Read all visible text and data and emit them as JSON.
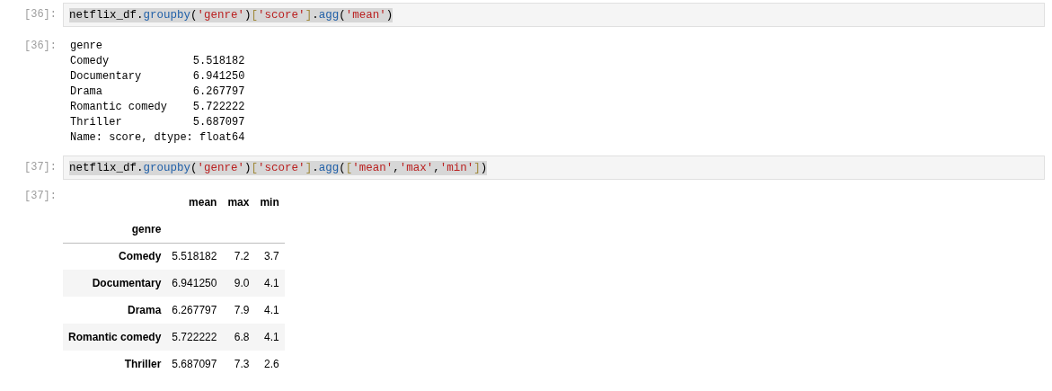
{
  "cells": [
    {
      "prompt_in": "[36]:",
      "input": {
        "highlighted": true,
        "tokens": [
          {
            "kind": "name",
            "text": "netflix_df"
          },
          {
            "kind": "op",
            "text": "."
          },
          {
            "kind": "func",
            "text": "groupby"
          },
          {
            "kind": "op",
            "text": "("
          },
          {
            "kind": "string",
            "text": "'genre'"
          },
          {
            "kind": "op",
            "text": ")"
          },
          {
            "kind": "bracket",
            "text": "["
          },
          {
            "kind": "string",
            "text": "'score'"
          },
          {
            "kind": "bracket",
            "text": "]"
          },
          {
            "kind": "op",
            "text": "."
          },
          {
            "kind": "func",
            "text": "agg"
          },
          {
            "kind": "op",
            "text": "("
          },
          {
            "kind": "string",
            "text": "'mean'"
          },
          {
            "kind": "op",
            "text": ")"
          }
        ]
      },
      "prompt_out": "[36]:",
      "output": {
        "kind": "text",
        "lines": [
          "genre",
          "Comedy             5.518182",
          "Documentary        6.941250",
          "Drama              6.267797",
          "Romantic comedy    5.722222",
          "Thriller           5.687097",
          "Name: score, dtype: float64"
        ]
      }
    },
    {
      "prompt_in": "[37]:",
      "input": {
        "highlighted": true,
        "tokens": [
          {
            "kind": "name",
            "text": "netflix_df"
          },
          {
            "kind": "op",
            "text": "."
          },
          {
            "kind": "func",
            "text": "groupby"
          },
          {
            "kind": "op",
            "text": "("
          },
          {
            "kind": "string",
            "text": "'genre'"
          },
          {
            "kind": "op",
            "text": ")"
          },
          {
            "kind": "bracket",
            "text": "["
          },
          {
            "kind": "string",
            "text": "'score'"
          },
          {
            "kind": "bracket",
            "text": "]"
          },
          {
            "kind": "op",
            "text": "."
          },
          {
            "kind": "func",
            "text": "agg"
          },
          {
            "kind": "op",
            "text": "("
          },
          {
            "kind": "bracket",
            "text": "["
          },
          {
            "kind": "string",
            "text": "'mean'"
          },
          {
            "kind": "op",
            "text": ","
          },
          {
            "kind": "string",
            "text": "'max'"
          },
          {
            "kind": "op",
            "text": ","
          },
          {
            "kind": "string",
            "text": "'min'"
          },
          {
            "kind": "bracket",
            "text": "]"
          },
          {
            "kind": "op",
            "text": ")"
          }
        ]
      },
      "prompt_out": "[37]:",
      "output": {
        "kind": "table",
        "columns": [
          "mean",
          "max",
          "min"
        ],
        "index_name": "genre",
        "rows": [
          {
            "index": "Comedy",
            "values": [
              "5.518182",
              "7.2",
              "3.7"
            ]
          },
          {
            "index": "Documentary",
            "values": [
              "6.941250",
              "9.0",
              "4.1"
            ]
          },
          {
            "index": "Drama",
            "values": [
              "6.267797",
              "7.9",
              "4.1"
            ]
          },
          {
            "index": "Romantic comedy",
            "values": [
              "5.722222",
              "6.8",
              "4.1"
            ]
          },
          {
            "index": "Thriller",
            "values": [
              "5.687097",
              "7.3",
              "2.6"
            ]
          }
        ]
      }
    }
  ]
}
